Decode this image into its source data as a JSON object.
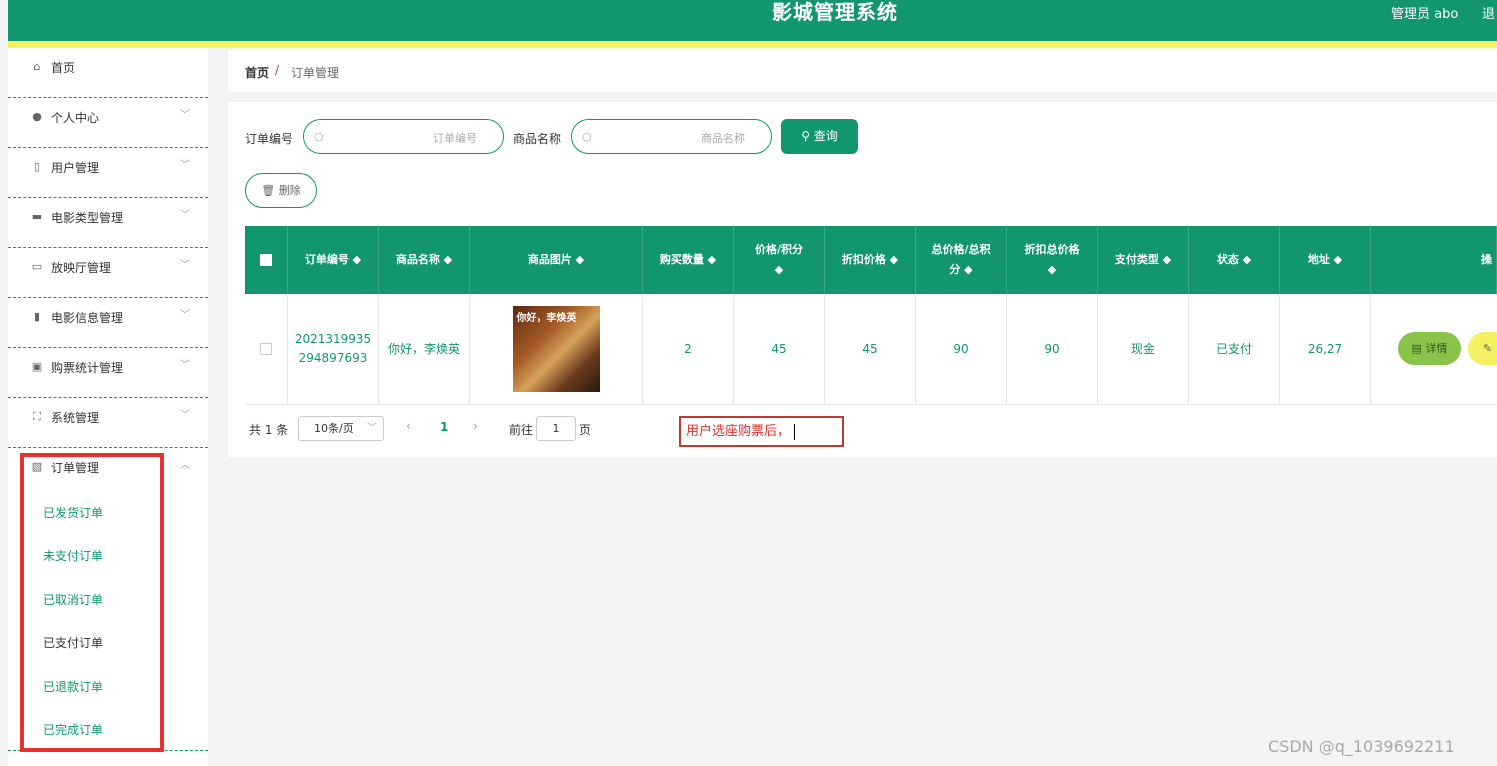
{
  "header": {
    "title": "影城管理系统",
    "admin_label": "管理员 abo",
    "logout_label": "退"
  },
  "sidebar": {
    "items": [
      {
        "label": "首页",
        "icon": "home-icon"
      },
      {
        "label": "个人中心",
        "icon": "user-icon"
      },
      {
        "label": "用户管理",
        "icon": "microphone-icon"
      },
      {
        "label": "电影类型管理",
        "icon": "printer-icon"
      },
      {
        "label": "放映厅管理",
        "icon": "message-icon"
      },
      {
        "label": "电影信息管理",
        "icon": "books-icon"
      },
      {
        "label": "购票统计管理",
        "icon": "briefcase-icon"
      },
      {
        "label": "系统管理",
        "icon": "fullscreen-icon"
      },
      {
        "label": "订单管理",
        "icon": "document-icon"
      }
    ],
    "submenu": [
      "已发货订单",
      "未支付订单",
      "已取消订单",
      "已支付订单",
      "已退款订单",
      "已完成订单"
    ],
    "active_submenu": "已支付订单"
  },
  "breadcrumb": {
    "home": "首页",
    "separator": "/",
    "current": "订单管理"
  },
  "search": {
    "order_no_label": "订单编号",
    "order_no_placeholder": "订单编号",
    "product_label": "商品名称",
    "product_placeholder": "商品名称",
    "query_button": "查询",
    "delete_button": "删除"
  },
  "table": {
    "columns": [
      "订单编号",
      "商品名称",
      "商品图片",
      "购买数量",
      "价格/积分",
      "折扣价格",
      "总价格/总积分",
      "折扣总价格",
      "支付类型",
      "状态",
      "地址",
      "操"
    ],
    "column_label_lines": {
      "price": [
        "价格/积分",
        "◆"
      ],
      "total": [
        "总价格/总积",
        "分 ◆"
      ],
      "discount_total": [
        "折扣总价格",
        "◆"
      ]
    },
    "rows": [
      {
        "order_no_line1": "2021319935",
        "order_no_line2": "294897693",
        "product_name": "你好，李焕英",
        "poster_text": "你好，李焕英",
        "quantity": "2",
        "price": "45",
        "discount_price": "45",
        "total_price": "90",
        "discount_total": "90",
        "pay_type": "现金",
        "status": "已支付",
        "address": "26,27",
        "detail_button": "详情",
        "edit_button": "修"
      }
    ]
  },
  "pagination": {
    "total": "共 1 条",
    "page_size": "10条/页",
    "current_page": "1",
    "goto_label": "前往",
    "goto_value": "1",
    "page_suffix": "页"
  },
  "annotation": {
    "text": "用户选座购票后，"
  },
  "watermark": "CSDN @q_1039692211",
  "colors": {
    "primary": "#12966f",
    "accent_yellow": "#f5f163",
    "highlight_red": "#e8312f",
    "detail_green": "#8bc34a"
  }
}
